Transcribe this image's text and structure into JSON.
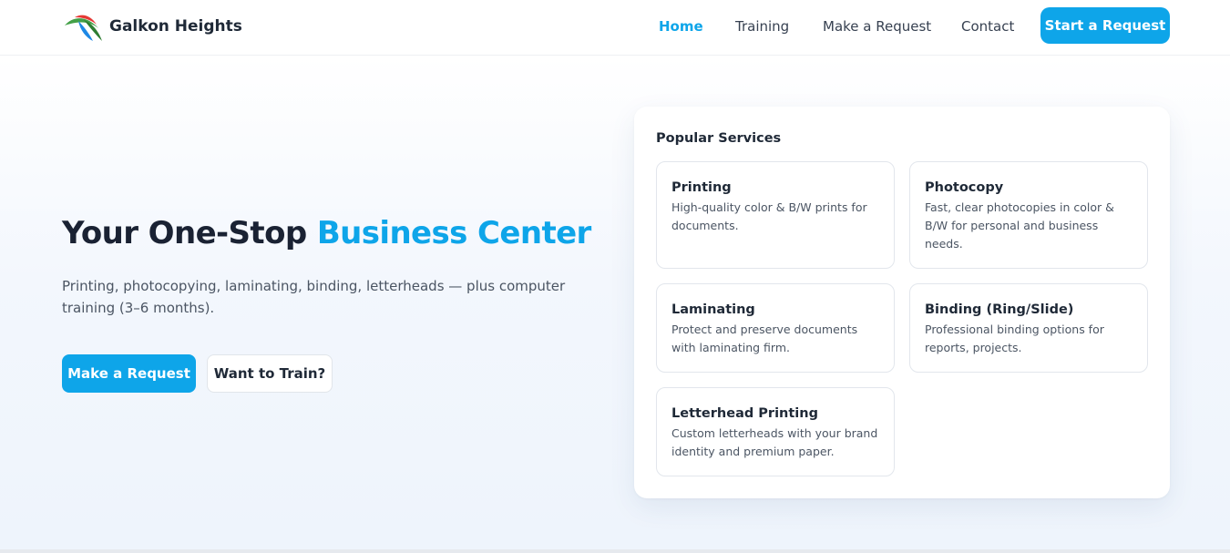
{
  "brand": {
    "name": "Galkon Heights",
    "logo_icon": "swoosh-logo-icon",
    "logo_colors": [
      "#e53935",
      "#43a047",
      "#1e88e5"
    ]
  },
  "nav": {
    "links": [
      "Home",
      "Training",
      "Make a Request",
      "Contact"
    ],
    "active": "Home",
    "cta": "Start a Request"
  },
  "hero": {
    "title_prefix": "Your One-Stop",
    "title_accent": "Business Center",
    "subtitle": "Printing, photocopying, laminating, binding, letterheads — plus computer training (3–6 months).",
    "primary_button": "Make a Request",
    "secondary_button": "Want to Train?"
  },
  "services": {
    "heading": "Popular Services",
    "items": [
      {
        "title": "Printing",
        "desc": "High-quality color & B/W prints for documents."
      },
      {
        "title": "Photocopy",
        "desc": "Fast, clear photocopies in color & B/W for personal and business needs."
      },
      {
        "title": "Laminating",
        "desc": "Protect and preserve documents with laminating firm."
      },
      {
        "title": "Binding (Ring/Slide)",
        "desc": "Professional binding options for reports, projects."
      },
      {
        "title": "Letterhead Printing",
        "desc": "Custom letterheads with your brand identity and premium paper."
      }
    ]
  },
  "colors": {
    "accent": "#0ea5e9",
    "text": "#1f2937",
    "muted": "#4b5563"
  }
}
